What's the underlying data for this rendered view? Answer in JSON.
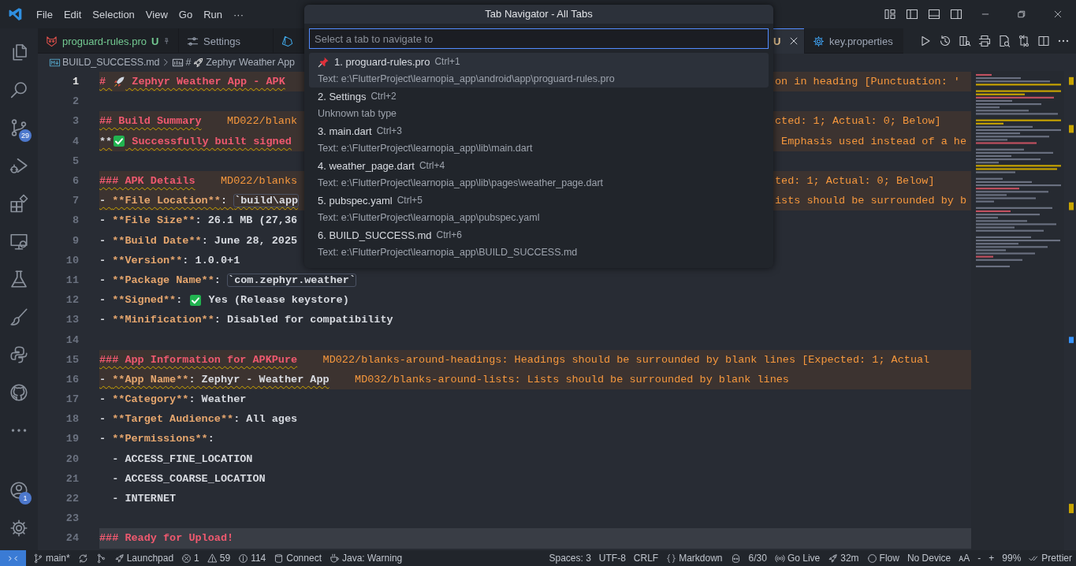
{
  "title_bar": {
    "menus": [
      "File",
      "Edit",
      "Selection",
      "View",
      "Go",
      "Run",
      "···"
    ]
  },
  "activity_bar": {
    "top": [
      {
        "selected": false
      },
      {
        "selected": false
      },
      {
        "badge": "29",
        "selected": false
      },
      {
        "selected": false
      },
      {
        "selected": false
      },
      {
        "selected": false
      },
      {
        "selected": false
      },
      {
        "selected": false
      },
      {
        "selected": false
      },
      {
        "selected": false
      },
      {
        "selected": false
      }
    ],
    "bottom": [
      {
        "badge": "1",
        "selected": false
      },
      {
        "selected": false
      }
    ]
  },
  "tabs": [
    {
      "label": "proguard-rules.pro",
      "status": "U",
      "color": "#73c991",
      "pinned": true,
      "selected": false
    },
    {
      "label": "Settings",
      "selected": false
    },
    {
      "selected": false
    },
    {
      "status": "U",
      "color": "#e2c08d",
      "selected": true
    },
    {
      "label": "key.properties",
      "selected": false
    }
  ],
  "breadcrumb": {
    "file": "BUILD_SUCCESS.md",
    "symbol_prefix": "#",
    "symbol": "Zephyr Weather App"
  },
  "lines": [
    {
      "number": "1",
      "active": true,
      "warning": true,
      "left": [
        {
          "kind": "h",
          "text": "# "
        },
        {
          "kind": "rocket"
        },
        {
          "kind": "h",
          "text": " Zephyr Weather App - APK"
        }
      ],
      "right": [
        {
          "kind": "diag",
          "text": "on in heading [Punctuation: '"
        }
      ]
    },
    {
      "number": "2"
    },
    {
      "number": "3",
      "warning": true,
      "left": [
        {
          "kind": "h",
          "text": "## Build Summary"
        },
        {
          "kind": "diag",
          "text": "    MD022/blank"
        }
      ],
      "right": [
        {
          "kind": "diag",
          "text": "cted: 1; Actual: 0; Below]"
        }
      ]
    },
    {
      "number": "4",
      "warning": true,
      "left": [
        {
          "kind": "p",
          "text": "**"
        },
        {
          "kind": "check"
        },
        {
          "kind": "h",
          "text": " Successfully built signed"
        }
      ],
      "right": [
        {
          "kind": "diag",
          "text": " Emphasis used instead of a he"
        }
      ]
    },
    {
      "number": "5"
    },
    {
      "number": "6",
      "warning": true,
      "left": [
        {
          "kind": "h",
          "text": "### APK Details"
        },
        {
          "kind": "diag",
          "text": "    MD022/blanks"
        }
      ],
      "right": [
        {
          "kind": "diag",
          "text": "ted: 1; Actual: 0; Below]"
        }
      ]
    },
    {
      "number": "7",
      "warning": true,
      "left": [
        {
          "kind": "p",
          "text": "- "
        },
        {
          "kind": "b",
          "text": "**File Location**"
        },
        {
          "kind": "p",
          "text": ": "
        },
        {
          "kind": "code",
          "text": "`build\\app"
        }
      ],
      "right": [
        {
          "kind": "diag",
          "text": "ists should be surrounded by b"
        }
      ]
    },
    {
      "number": "8",
      "left": [
        {
          "kind": "p",
          "text": "- "
        },
        {
          "kind": "b",
          "text": "**File Size**"
        },
        {
          "kind": "p",
          "text": ": 26.1 MB (27,36"
        }
      ]
    },
    {
      "number": "9",
      "left": [
        {
          "kind": "p",
          "text": "- "
        },
        {
          "kind": "b",
          "text": "**Build Date**"
        },
        {
          "kind": "p",
          "text": ": June 28, 2025"
        }
      ]
    },
    {
      "number": "10",
      "left": [
        {
          "kind": "p",
          "text": "- "
        },
        {
          "kind": "b",
          "text": "**Version**"
        },
        {
          "kind": "p",
          "text": ": 1.0.0+1"
        }
      ]
    },
    {
      "number": "11",
      "left": [
        {
          "kind": "p",
          "text": "- "
        },
        {
          "kind": "b",
          "text": "**Package Name**"
        },
        {
          "kind": "p",
          "text": ": "
        },
        {
          "kind": "code",
          "text": "`com.zephyr.weather`"
        }
      ]
    },
    {
      "number": "12",
      "left": [
        {
          "kind": "p",
          "text": "- "
        },
        {
          "kind": "b",
          "text": "**Signed**"
        },
        {
          "kind": "p",
          "text": ": "
        },
        {
          "kind": "check"
        },
        {
          "kind": "p",
          "text": " Yes (Release keystore)"
        }
      ]
    },
    {
      "number": "13",
      "left": [
        {
          "kind": "p",
          "text": "- "
        },
        {
          "kind": "b",
          "text": "**Minification**"
        },
        {
          "kind": "p",
          "text": ": Disabled for compatibility"
        }
      ]
    },
    {
      "number": "14"
    },
    {
      "number": "15",
      "warning": true,
      "left": [
        {
          "kind": "h",
          "text": "### App Information for APKPure"
        },
        {
          "kind": "diag",
          "text": "    MD022/blanks-around-headings: Headings should be surrounded by blank lines [Expected: 1; Actual"
        }
      ]
    },
    {
      "number": "16",
      "warning": true,
      "left": [
        {
          "kind": "p",
          "text": "- "
        },
        {
          "kind": "b",
          "text": "**App Name**"
        },
        {
          "kind": "p",
          "text": ": Zephyr - Weather App"
        },
        {
          "kind": "diag",
          "text": "    MD032/blanks-around-lists: Lists should be surrounded by blank lines"
        }
      ]
    },
    {
      "number": "17",
      "left": [
        {
          "kind": "p",
          "text": "- "
        },
        {
          "kind": "b",
          "text": "**Category**"
        },
        {
          "kind": "p",
          "text": ": Weather"
        }
      ]
    },
    {
      "number": "18",
      "left": [
        {
          "kind": "p",
          "text": "- "
        },
        {
          "kind": "b",
          "text": "**Target Audience**"
        },
        {
          "kind": "p",
          "text": ": All ages"
        }
      ]
    },
    {
      "number": "19",
      "left": [
        {
          "kind": "p",
          "text": "- "
        },
        {
          "kind": "b",
          "text": "**Permissions**"
        },
        {
          "kind": "p",
          "text": ":"
        }
      ]
    },
    {
      "number": "20",
      "left": [
        {
          "kind": "p",
          "text": "  - ACCESS_FINE_LOCATION"
        }
      ]
    },
    {
      "number": "21",
      "left": [
        {
          "kind": "p",
          "text": "  - ACCESS_COARSE_LOCATION"
        }
      ]
    },
    {
      "number": "22",
      "left": [
        {
          "kind": "p",
          "text": "  - INTERNET"
        }
      ]
    },
    {
      "number": "23"
    },
    {
      "number": "24",
      "highlighted": true,
      "left": [
        {
          "kind": "h",
          "text": "### Ready for Upload!"
        }
      ]
    }
  ],
  "quick_pick": {
    "title": "Tab Navigator - All Tabs",
    "placeholder": "Select a tab to navigate to",
    "items": [
      {
        "label": "1. proguard-rules.pro",
        "shortcut": "Ctrl+1",
        "detail": "Text: e:\\FlutterProject\\learnopia_app\\android\\app\\proguard-rules.pro",
        "pinned": true,
        "selected": true
      },
      {
        "label": "2. Settings",
        "shortcut": "Ctrl+2",
        "detail": "Unknown tab type",
        "pinned": false,
        "selected": false
      },
      {
        "label": "3. main.dart",
        "shortcut": "Ctrl+3",
        "detail": "Text: e:\\FlutterProject\\learnopia_app\\lib\\main.dart",
        "pinned": false,
        "selected": false
      },
      {
        "label": "4. weather_page.dart",
        "shortcut": "Ctrl+4",
        "detail": "Text: e:\\FlutterProject\\learnopia_app\\lib\\pages\\weather_page.dart",
        "pinned": false,
        "selected": false
      },
      {
        "label": "5. pubspec.yaml",
        "shortcut": "Ctrl+5",
        "detail": "Text: e:\\FlutterProject\\learnopia_app\\pubspec.yaml",
        "pinned": false,
        "selected": false
      },
      {
        "label": "6. BUILD_SUCCESS.md",
        "shortcut": "Ctrl+6",
        "detail": "Text: e:\\FlutterProject\\learnopia_app\\BUILD_SUCCESS.md",
        "pinned": false,
        "selected": false
      }
    ]
  },
  "status_bar": {
    "left": [
      {
        "kind": "icon"
      },
      {
        "kind": "text",
        "text": "main*"
      },
      {
        "kind": "icon"
      },
      {
        "kind": "icon"
      },
      {
        "kind": "text",
        "text": "Launchpad"
      },
      {
        "kind": "text",
        "text": "1"
      },
      {
        "kind": "text",
        "text": "59"
      },
      {
        "kind": "text",
        "text": "114"
      },
      {
        "kind": "text",
        "text": "Connect"
      },
      {
        "kind": "text",
        "text": "Java: Warning"
      }
    ],
    "right": [
      {
        "kind": "text",
        "text": "Spaces: 3"
      },
      {
        "kind": "text",
        "text": "UTF-8"
      },
      {
        "kind": "text",
        "text": "CRLF"
      },
      {
        "kind": "text",
        "text": "Markdown"
      },
      {
        "kind": "icon"
      },
      {
        "kind": "text",
        "text": "6/30"
      },
      {
        "kind": "text",
        "text": "Go Live"
      },
      {
        "kind": "text",
        "text": "32m"
      },
      {
        "kind": "text",
        "text": "Flow"
      },
      {
        "kind": "text",
        "text": "No Device"
      },
      {
        "kind": "text",
        "text": "ᴀA"
      },
      {
        "kind": "text",
        "text": "-"
      },
      {
        "kind": "text",
        "text": "+"
      },
      {
        "kind": "text",
        "text": "99%"
      },
      {
        "kind": "text",
        "text": "Prettier"
      }
    ]
  }
}
